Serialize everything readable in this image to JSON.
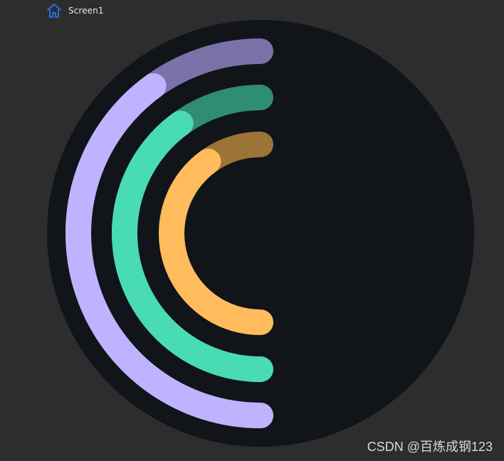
{
  "header": {
    "screen_label": "Screen1",
    "home_icon": "home-icon"
  },
  "theme": {
    "page_bg": "#2d2d2d",
    "circle_bg": "#111418",
    "icon_color": "#1e73e8"
  },
  "arcs": [
    {
      "name": "outer-arc",
      "value": 0.8,
      "color": "#bfb3ff",
      "track_color": "#7a72a8"
    },
    {
      "name": "middle-arc",
      "value": 0.8,
      "color": "#48dbb4",
      "track_color": "#2f8d71"
    },
    {
      "name": "inner-arc",
      "value": 0.8,
      "color": "#ffbb5c",
      "track_color": "#9b7436"
    }
  ],
  "watermark": "CSDN @百炼成钢123"
}
